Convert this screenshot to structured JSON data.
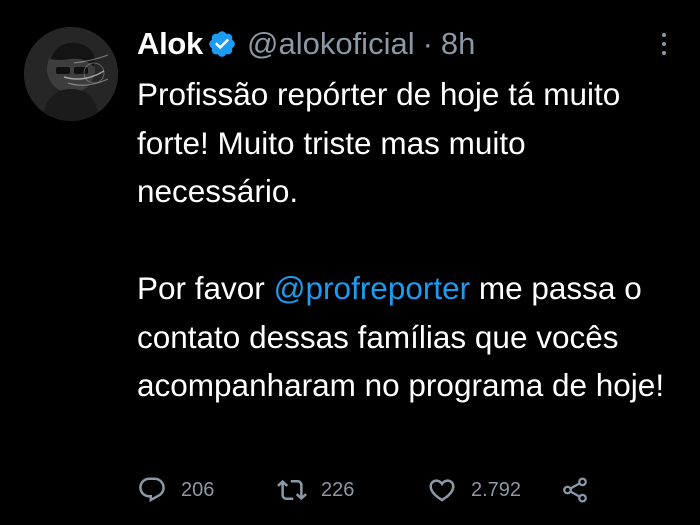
{
  "tweet": {
    "author_name": "Alok",
    "handle": "@alokoficial",
    "separator": "·",
    "time": "8h",
    "paragraph1": "Profissão repórter de hoje tá muito forte! Muito triste mas muito necessário.",
    "paragraph2_before": "Por favor ",
    "mention": "@profreporter",
    "paragraph2_after": " me passa o contato dessas famílias que vocês acompanharam no programa de hoje!",
    "reply_count": "206",
    "retweet_count": "226",
    "like_count": "2.792"
  },
  "colors": {
    "background": "#000000",
    "text": "#ffffff",
    "secondary": "#8b98a5",
    "accent": "#1d9bf0"
  },
  "icons": [
    "verified-badge-icon",
    "more-options-icon",
    "reply-icon",
    "retweet-icon",
    "like-icon",
    "share-icon"
  ]
}
